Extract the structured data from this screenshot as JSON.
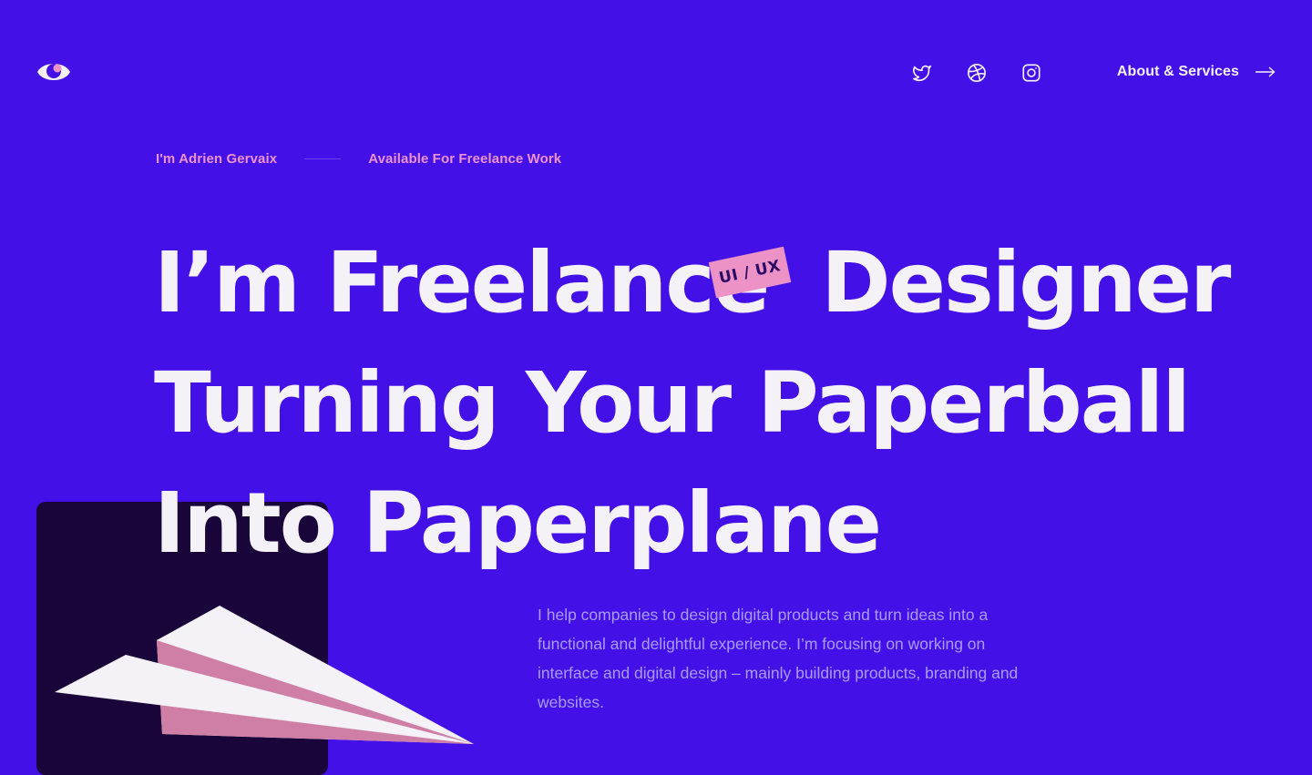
{
  "header": {
    "logo_icon": "eye-icon",
    "social": [
      {
        "name": "twitter",
        "icon": "twitter-icon"
      },
      {
        "name": "dribbble",
        "icon": "dribbble-icon"
      },
      {
        "name": "instagram",
        "icon": "instagram-icon"
      }
    ],
    "about_link_label": "About & Services",
    "about_link_icon": "arrow-right-icon"
  },
  "intro": {
    "name": "I'm Adrien Gervaix",
    "availability": "Available For Freelance Work"
  },
  "headline": {
    "line1_part1": "I’m Freelance",
    "line1_part2": "Designer",
    "line2": "Turning Your Paperball",
    "line3": "Into Paperplane",
    "tag": "UI / UX"
  },
  "description": "I help companies to design digital products and turn ideas into a functional and delightful experience. I’m focusing on working on interface and digital design – mainly building products, branding and websites.",
  "decoration": {
    "illustration_icon": "paper-plane-icon"
  },
  "colors": {
    "background": "#4310e8",
    "accent_pink": "#ec92c6",
    "text_light": "#f4f1f7",
    "card_dark": "#1a053a",
    "description_text": "#a99cf7"
  }
}
